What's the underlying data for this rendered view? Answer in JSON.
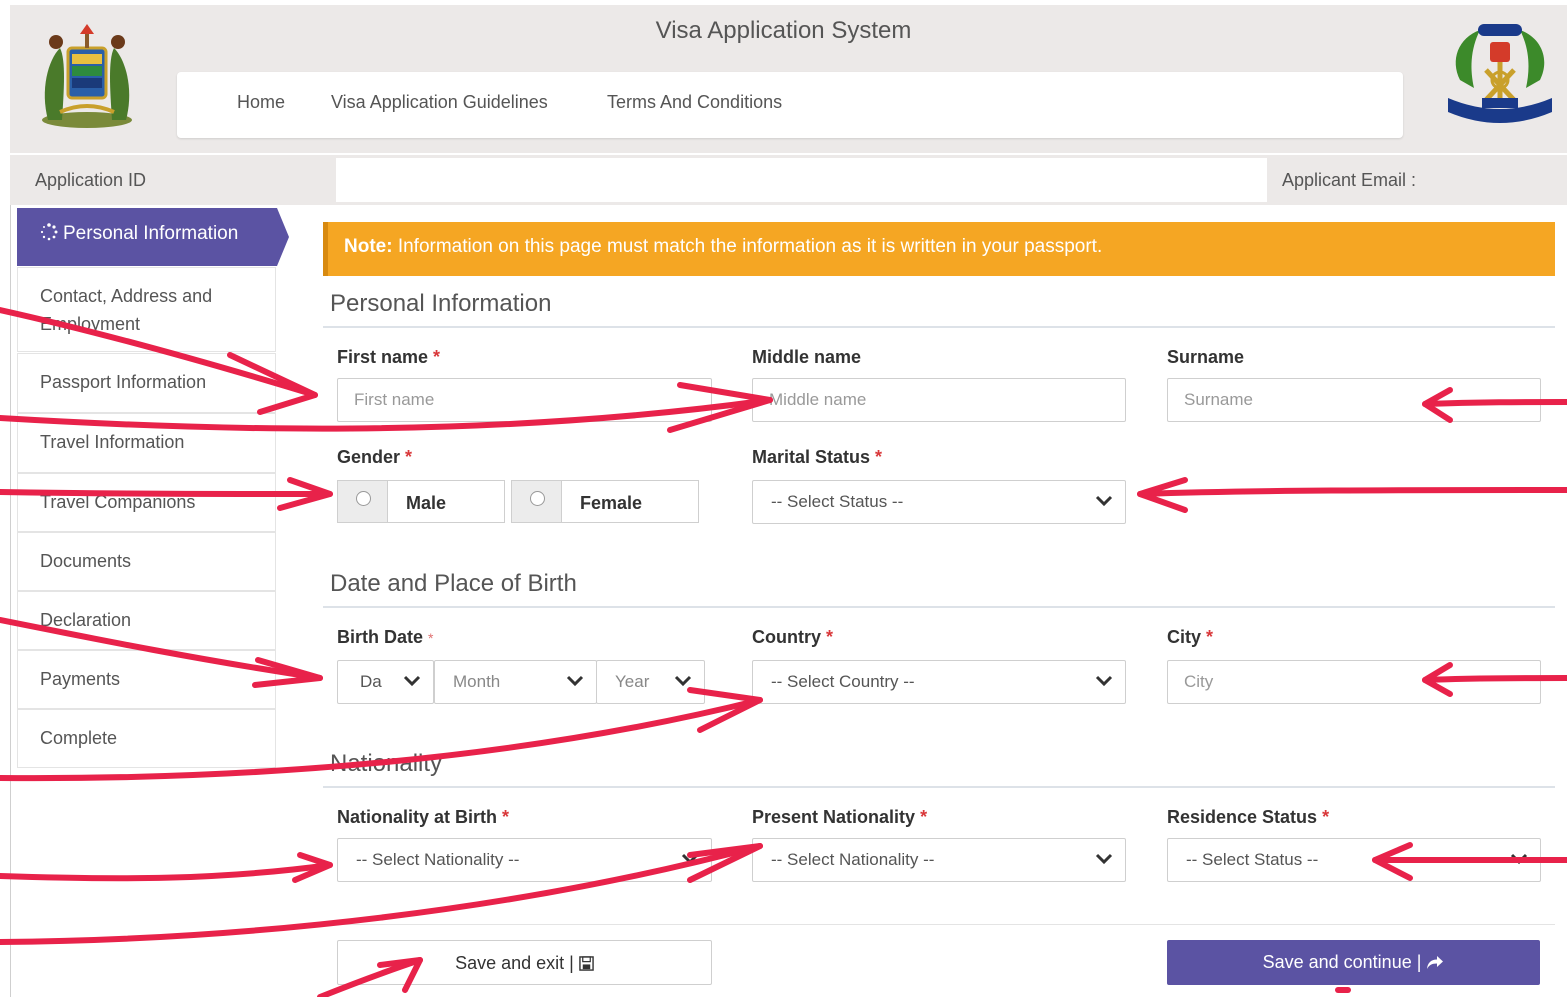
{
  "header": {
    "title": "Visa Application System",
    "nav": [
      "Home",
      "Visa Application Guidelines",
      "Terms And Conditions"
    ]
  },
  "info_bar": {
    "application_id_label": "Application ID",
    "applicant_email_label": "Applicant Email :"
  },
  "sidebar": {
    "items": [
      "Personal Information",
      "Contact, Address and Employment",
      "Passport Information",
      "Travel Information",
      "Travel Companions",
      "Documents",
      "Declaration",
      "Payments",
      "Complete"
    ],
    "active_index": 0
  },
  "note": {
    "prefix": "Note:",
    "text": " Information on this page must match the information as it is written in your passport."
  },
  "sections": {
    "personal": "Personal Information",
    "birth": "Date and Place of Birth",
    "nationality": "Nationality"
  },
  "fields": {
    "first_name": {
      "label": "First name",
      "placeholder": "First name"
    },
    "middle_name": {
      "label": "Middle name",
      "placeholder": "Middle name"
    },
    "surname": {
      "label": "Surname",
      "placeholder": "Surname"
    },
    "gender": {
      "label": "Gender",
      "options": [
        "Male",
        "Female"
      ]
    },
    "marital_status": {
      "label": "Marital Status",
      "value": "-- Select Status --"
    },
    "birth_date": {
      "label": "Birth Date",
      "day": "Da",
      "month": "Month",
      "year": "Year"
    },
    "country": {
      "label": "Country",
      "value": "-- Select Country --"
    },
    "city": {
      "label": "City",
      "placeholder": "City"
    },
    "nationality_at_birth": {
      "label": "Nationality at Birth",
      "value": "-- Select Nationality --"
    },
    "present_nationality": {
      "label": "Present Nationality",
      "value": "-- Select Nationality --"
    },
    "residence_status": {
      "label": "Residence Status",
      "value": "-- Select Status --"
    }
  },
  "required_mark": "*",
  "buttons": {
    "save_exit": "Save and exit |",
    "save_continue": "Save and continue |"
  },
  "colors": {
    "accent": "#5b53a3",
    "note": "#f5a623",
    "annotation": "#e8224a",
    "required": "#d9383a"
  }
}
